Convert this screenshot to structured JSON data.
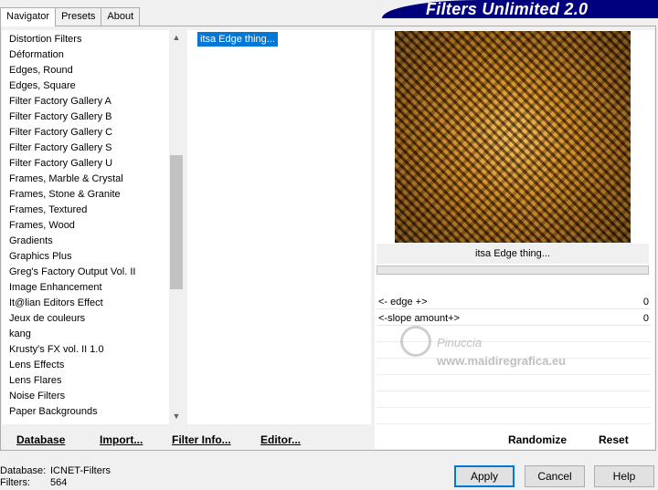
{
  "tabs": [
    "Navigator",
    "Presets",
    "About"
  ],
  "banner": "Filters Unlimited 2.0",
  "categories": [
    "Distortion Filters",
    "Déformation",
    "Edges, Round",
    "Edges, Square",
    "Filter Factory Gallery A",
    "Filter Factory Gallery B",
    "Filter Factory Gallery C",
    "Filter Factory Gallery S",
    "Filter Factory Gallery U",
    "Frames, Marble & Crystal",
    "Frames, Stone & Granite",
    "Frames, Textured",
    "Frames, Wood",
    "Gradients",
    "Graphics Plus",
    "Greg's Factory Output Vol. II",
    "Image Enhancement",
    "It@lian Editors Effect",
    "Jeux de couleurs",
    "kang",
    "Krusty's FX vol. II 1.0",
    "Lens Effects",
    "Lens Flares",
    "Noise Filters",
    "Paper Backgrounds"
  ],
  "selected_filter": "itsa Edge thing...",
  "preview_title": "itsa Edge thing...",
  "params": [
    {
      "label": "<- edge +>",
      "value": "0"
    },
    {
      "label": "<-slope amount+>",
      "value": "0"
    }
  ],
  "watermark": {
    "line1": "Pinuccia",
    "line2": "www.maidiregrafica.eu"
  },
  "bottom_links": {
    "database": "Database",
    "import": "Import...",
    "filter_info": "Filter Info...",
    "editor": "Editor...",
    "randomize": "Randomize",
    "reset": "Reset"
  },
  "status": {
    "database_label": "Database:",
    "database_value": "ICNET-Filters",
    "filters_label": "Filters:",
    "filters_value": "564"
  },
  "dialog": {
    "apply": "Apply",
    "cancel": "Cancel",
    "help": "Help"
  },
  "colors": {
    "banner": "#00007e",
    "selection": "#0078d7"
  }
}
